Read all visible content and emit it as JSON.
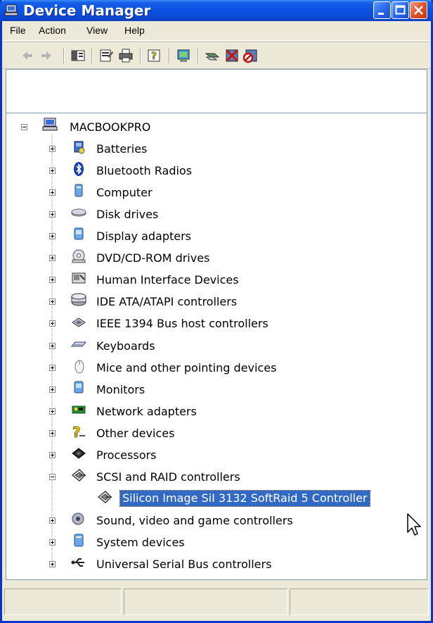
{
  "window": {
    "title": "Device Manager"
  },
  "menu": {
    "items": [
      "File",
      "Action",
      "View",
      "Help"
    ]
  },
  "toolbar": {
    "icons": [
      "back-icon",
      "forward-icon",
      "show-hide-console-tree-icon",
      "properties-icon",
      "print-icon",
      "help-icon",
      "scan-hardware-icon",
      "update-driver-icon",
      "uninstall-icon",
      "disable-icon"
    ]
  },
  "tree": {
    "root": "MACBOOKPRO",
    "items": [
      {
        "label": "Batteries",
        "icon": "battery-icon"
      },
      {
        "label": "Bluetooth Radios",
        "icon": "bluetooth-icon"
      },
      {
        "label": "Computer",
        "icon": "computer-icon"
      },
      {
        "label": "Disk drives",
        "icon": "disk-drive-icon"
      },
      {
        "label": "Display adapters",
        "icon": "display-adapter-icon"
      },
      {
        "label": "DVD/CD-ROM drives",
        "icon": "dvd-drive-icon"
      },
      {
        "label": "Human Interface Devices",
        "icon": "hid-icon"
      },
      {
        "label": "IDE ATA/ATAPI controllers",
        "icon": "ide-controller-icon"
      },
      {
        "label": "IEEE 1394 Bus host controllers",
        "icon": "firewire-icon"
      },
      {
        "label": "Keyboards",
        "icon": "keyboard-icon"
      },
      {
        "label": "Mice and other pointing devices",
        "icon": "mouse-icon"
      },
      {
        "label": "Monitors",
        "icon": "monitor-icon"
      },
      {
        "label": "Network adapters",
        "icon": "network-adapter-icon"
      },
      {
        "label": "Other devices",
        "icon": "unknown-device-icon"
      },
      {
        "label": "Processors",
        "icon": "processor-icon"
      },
      {
        "label": "SCSI and RAID controllers",
        "icon": "scsi-controller-icon",
        "expanded": true
      },
      {
        "label": "Silicon Image SiI 3132 SoftRaid 5 Controller",
        "icon": "scsi-controller-icon",
        "child": true,
        "selected": true
      },
      {
        "label": "Sound, video and game controllers",
        "icon": "sound-icon"
      },
      {
        "label": "System devices",
        "icon": "system-device-icon"
      },
      {
        "label": "Universal Serial Bus controllers",
        "icon": "usb-icon"
      }
    ]
  },
  "colors": {
    "title_bar": "#0a54e3",
    "selection": "#316ac5",
    "chrome": "#ece9d8"
  }
}
